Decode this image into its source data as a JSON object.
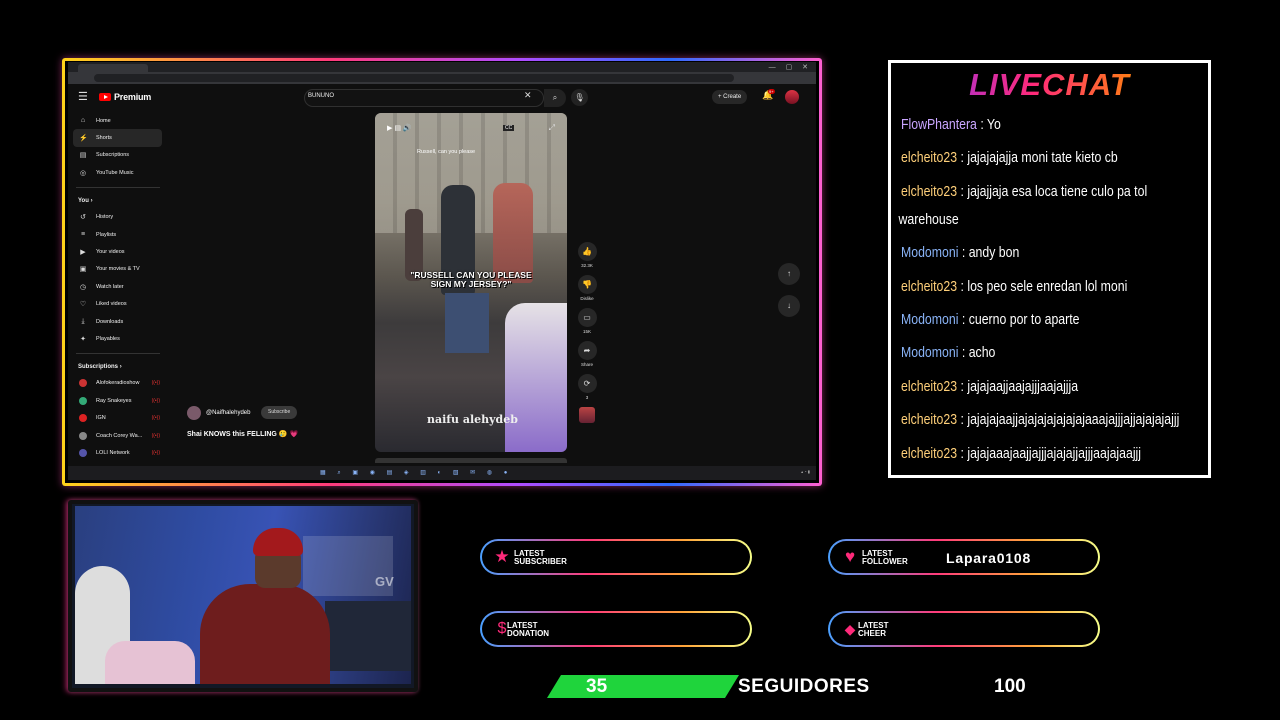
{
  "browser": {
    "window_controls": "— ▢ ✕"
  },
  "youtube": {
    "logo_text": "Premium",
    "search": {
      "value": "BUNUNO"
    },
    "create_label": "Create",
    "notification_badge": "9+",
    "sidebar": {
      "main": [
        {
          "label": "Home",
          "icon": "home-icon",
          "glyph": "⌂"
        },
        {
          "label": "Shorts",
          "icon": "shorts-icon",
          "glyph": "⚡"
        },
        {
          "label": "Subscriptions",
          "icon": "subscriptions-icon",
          "glyph": "▤"
        },
        {
          "label": "YouTube Music",
          "icon": "music-icon",
          "glyph": "◎"
        }
      ],
      "you_heading": "You",
      "you": [
        {
          "label": "History",
          "icon": "history-icon",
          "glyph": "↺"
        },
        {
          "label": "Playlists",
          "icon": "playlists-icon",
          "glyph": "≡"
        },
        {
          "label": "Your videos",
          "icon": "your-videos-icon",
          "glyph": "▶"
        },
        {
          "label": "Your movies & TV",
          "icon": "movies-icon",
          "glyph": "▣"
        },
        {
          "label": "Watch later",
          "icon": "watch-later-icon",
          "glyph": "◷"
        },
        {
          "label": "Liked videos",
          "icon": "liked-icon",
          "glyph": "👍"
        },
        {
          "label": "Downloads",
          "icon": "downloads-icon",
          "glyph": "⤓"
        },
        {
          "label": "Playables",
          "icon": "playables-icon",
          "glyph": "✦"
        }
      ],
      "subscriptions_heading": "Subscriptions",
      "subscriptions": [
        {
          "label": "Alofokeradioshow",
          "color": "#c33"
        },
        {
          "label": "Ray Snakeyes",
          "color": "#3a7"
        },
        {
          "label": "IGN",
          "color": "#d22"
        },
        {
          "label": "Coach Corey Wa...",
          "color": "#888"
        },
        {
          "label": "LOLI Network",
          "color": "#55a"
        }
      ]
    },
    "short": {
      "small_caption": "Russell, can you please",
      "caption": "\"RUSSELL CAN YOU PLEASE SIGN MY JERSEY?\"",
      "watermark": "naifu alehydeb",
      "channel": "@Naifhalehydeb",
      "subscribe_label": "Subscribe",
      "title": "Shai KNOWS this FELLING 🥲 💗",
      "likes": "32.3K",
      "dislike_label": "Dislike",
      "comments": "15K",
      "share_label": "Share",
      "remix_count": "3"
    }
  },
  "chat": {
    "title": "LIVECHAT",
    "messages": [
      {
        "user": "FlowPhantera",
        "color": "#c9a6ff",
        "text": "Yo"
      },
      {
        "user": "elcheito23",
        "color": "#ffd07a",
        "text": "jajajajajja moni tate kieto cb"
      },
      {
        "user": "elcheito23",
        "color": "#ffd07a",
        "text": "jajajjaja esa loca tiene culo pa tol",
        "continuation": "warehouse"
      },
      {
        "user": "Modomoni",
        "color": "#8ab4f8",
        "text": "andy bon"
      },
      {
        "user": "elcheito23",
        "color": "#ffd07a",
        "text": "los peo sele enredan lol moni"
      },
      {
        "user": "Modomoni",
        "color": "#8ab4f8",
        "text": "cuerno por to aparte"
      },
      {
        "user": "Modomoni",
        "color": "#8ab4f8",
        "text": "acho"
      },
      {
        "user": "elcheito23",
        "color": "#ffd07a",
        "text": "jajajaajjaajajjjaajajjja"
      },
      {
        "user": "elcheito23",
        "color": "#ffd07a",
        "text": "jajajajaajjajajajajajajajaaajajjjajjajajajajjj"
      },
      {
        "user": "elcheito23",
        "color": "#ffd07a",
        "text": "jajajaaajaajjajjjajajajjajjjaajajaajjj"
      }
    ]
  },
  "alerts": {
    "subscriber": {
      "label_1": "LATEST",
      "label_2": "SUBSCRIBER",
      "value": ""
    },
    "follower": {
      "label_1": "LATEST",
      "label_2": "FOLLOWER",
      "value": "Lapara0108"
    },
    "donation": {
      "label_1": "LATEST",
      "label_2": "DONATION",
      "value": ""
    },
    "cheer": {
      "label_1": "LATEST",
      "label_2": "CHEER",
      "value": ""
    }
  },
  "goal": {
    "current": "35",
    "label": "SEGUIDORES",
    "target": "100",
    "fill_color": "#1fd43c"
  }
}
